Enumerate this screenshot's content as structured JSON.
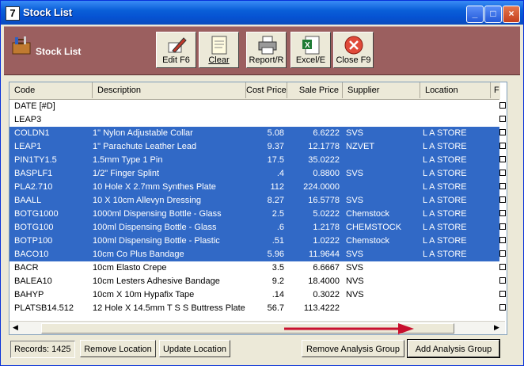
{
  "window": {
    "title": "Stock List",
    "icon": "7"
  },
  "toolbar": {
    "title": "Stock List",
    "buttons": [
      {
        "label": "Edit F6",
        "icon": "edit-icon"
      },
      {
        "label": "Clear",
        "icon": "clear-icon"
      },
      {
        "label": "Report/R",
        "icon": "printer-icon"
      },
      {
        "label": "Excel/E",
        "icon": "excel-icon"
      },
      {
        "label": "Close F9",
        "icon": "close-circle-icon"
      }
    ]
  },
  "grid": {
    "columns": [
      "Code",
      "Description",
      "Cost Price",
      "Sale Price",
      "Supplier",
      "Location",
      "F"
    ],
    "rows": [
      {
        "code": "DATE [#D]",
        "desc": "",
        "cost": "",
        "sale": "",
        "supplier": "",
        "location": "",
        "sel": false
      },
      {
        "code": "LEAP3",
        "desc": "",
        "cost": "",
        "sale": "",
        "supplier": "",
        "location": "",
        "sel": false
      },
      {
        "code": "COLDN1",
        "desc": "1\" Nylon Adjustable Collar",
        "cost": "5.08",
        "sale": "6.6222",
        "supplier": "SVS",
        "location": "L A STORE",
        "sel": true
      },
      {
        "code": "LEAP1",
        "desc": "1\" Parachute Leather Lead",
        "cost": "9.37",
        "sale": "12.1778",
        "supplier": "NZVET",
        "location": "L A STORE",
        "sel": true
      },
      {
        "code": "PIN1TY1.5",
        "desc": "1.5mm Type 1 Pin",
        "cost": "17.5",
        "sale": "35.0222",
        "supplier": "",
        "location": "L A STORE",
        "sel": true
      },
      {
        "code": "BASPLF1",
        "desc": "1/2\" Finger Splint",
        "cost": ".4",
        "sale": "0.8800",
        "supplier": "SVS",
        "location": "L A STORE",
        "sel": true
      },
      {
        "code": "PLA2.710",
        "desc": "10 Hole X 2.7mm Synthes Plate",
        "cost": "112",
        "sale": "224.0000",
        "supplier": "",
        "location": "L A STORE",
        "sel": true
      },
      {
        "code": "BAALL",
        "desc": "10 X 10cm Allevyn Dressing",
        "cost": "8.27",
        "sale": "16.5778",
        "supplier": "SVS",
        "location": "L A STORE",
        "sel": true
      },
      {
        "code": "BOTG1000",
        "desc": "1000ml Dispensing Bottle - Glass",
        "cost": "2.5",
        "sale": "5.0222",
        "supplier": "Chemstock",
        "location": "L A STORE",
        "sel": true
      },
      {
        "code": "BOTG100",
        "desc": "100ml Dispensing Bottle - Glass",
        "cost": ".6",
        "sale": "1.2178",
        "supplier": "CHEMSTOCK",
        "location": "L A STORE",
        "sel": true
      },
      {
        "code": "BOTP100",
        "desc": "100ml Dispensing Bottle - Plastic",
        "cost": ".51",
        "sale": "1.0222",
        "supplier": "Chemstock",
        "location": "L A STORE",
        "sel": true
      },
      {
        "code": "BACO10",
        "desc": "10cm Co Plus Bandage",
        "cost": "5.96",
        "sale": "11.9644",
        "supplier": "SVS",
        "location": "L A STORE",
        "sel": true
      },
      {
        "code": "BACR",
        "desc": "10cm Elasto Crepe",
        "cost": "3.5",
        "sale": "6.6667",
        "supplier": "SVS",
        "location": "",
        "sel": false
      },
      {
        "code": "BALEA10",
        "desc": "10cm Lesters Adhesive Bandage",
        "cost": "9.2",
        "sale": "18.4000",
        "supplier": "NVS",
        "location": "",
        "sel": false
      },
      {
        "code": "BAHYP",
        "desc": "10cm X 10m Hypafix Tape",
        "cost": ".14",
        "sale": "0.3022",
        "supplier": "NVS",
        "location": "",
        "sel": false
      },
      {
        "code": "PLATSB14.512",
        "desc": "12 Hole X 14.5mm T S S Buttress Plate",
        "cost": "56.7",
        "sale": "113.4222",
        "supplier": "",
        "location": "",
        "sel": false
      }
    ]
  },
  "footer": {
    "records": "Records: 1425",
    "remove_location": "Remove Location",
    "update_location": "Update Location",
    "remove_group": "Remove Analysis Group",
    "add_group": "Add Analysis Group"
  },
  "colors": {
    "selection": "#3169c6",
    "toolbar": "#9b5f5f",
    "titlebar": "#0a5fd8",
    "arrow": "#c8102e"
  }
}
